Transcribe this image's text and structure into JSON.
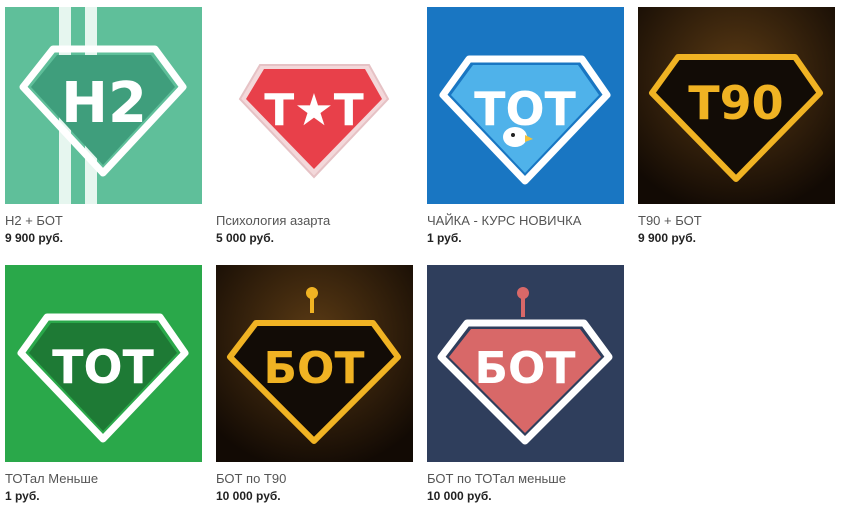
{
  "products": [
    {
      "title": "H2 + БОТ",
      "price": "9 900 руб.",
      "logo_text": "H2",
      "colors": {
        "background": "#5fbf9a",
        "diamond": "#3f9e7c",
        "outline": "#ffffff",
        "text": "#ffffff",
        "stripes": "#e6f6ef"
      }
    },
    {
      "title": "Психология азарта",
      "price": "5 000 руб.",
      "logo_text": "T★T",
      "colors": {
        "background": "#ffffff",
        "diamond": "#e8404a",
        "outline": "#ffffff",
        "text": "#ffffff"
      }
    },
    {
      "title": "ЧАЙКА - КУРС НОВИЧКА",
      "price": "1 руб.",
      "logo_text": "TOT",
      "colors": {
        "background": "#1976c2",
        "diamond": "#4fb2ea",
        "outline": "#ffffff",
        "text": "#ffffff"
      }
    },
    {
      "title": "T90 + БОТ",
      "price": "9 900 руб.",
      "logo_text": "T90",
      "colors": {
        "background": "#2a1c10",
        "diamond": "#120c06",
        "outline": "#f0b323",
        "text": "#f0b323"
      }
    },
    {
      "title": "ТОТал Меньше",
      "price": "1 руб.",
      "logo_text": "TOT",
      "colors": {
        "background": "#2aa84a",
        "diamond": "#1e7a35",
        "outline": "#ffffff",
        "text": "#ffffff"
      }
    },
    {
      "title": "БОТ по T90",
      "price": "10 000 руб.",
      "logo_text": "БОТ",
      "colors": {
        "background": "#2a1c10",
        "diamond": "#120c06",
        "outline": "#f0b323",
        "text": "#f0b323"
      }
    },
    {
      "title": "БОТ по ТОТал меньше",
      "price": "10 000 руб.",
      "logo_text": "БОТ",
      "colors": {
        "background": "#2f3e5c",
        "diamond": "#d86868",
        "outline": "#ffffff",
        "text": "#ffffff"
      }
    }
  ]
}
